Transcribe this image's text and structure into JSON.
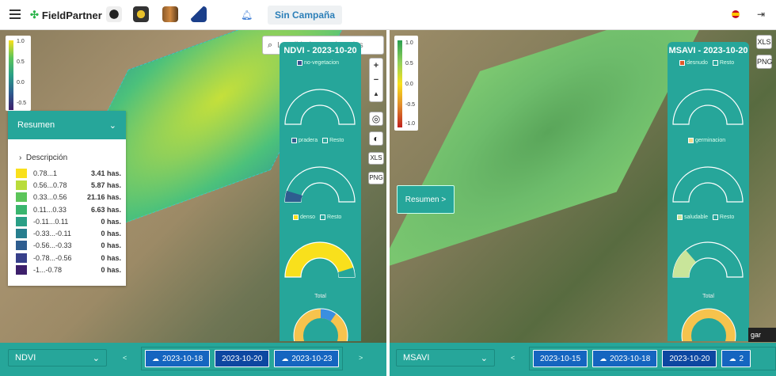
{
  "app": {
    "name": "FieldPartner",
    "campaign": "Sin Campaña"
  },
  "icons": {
    "menu": "hamburger-icon",
    "bell": "bell-icon",
    "flag": "spain-flag-icon",
    "logout": "logout-icon"
  },
  "search": {
    "placeholder": "Localidad, Coordenadas"
  },
  "left": {
    "legend": {
      "ticks": [
        "1.0",
        "0.5",
        "0.0",
        "-0.5"
      ]
    },
    "resumen": {
      "title": "Resumen",
      "description": "Descripción",
      "rows": [
        {
          "range": "0.78...1",
          "value": "3.41 has.",
          "color": "#f9e01c"
        },
        {
          "range": "0.56...0.78",
          "value": "5.87 has.",
          "color": "#b9dc3a"
        },
        {
          "range": "0.33...0.56",
          "value": "21.16 has.",
          "color": "#5cc55a"
        },
        {
          "range": "0.11...0.33",
          "value": "6.63 has.",
          "color": "#39b56e"
        },
        {
          "range": "-0.11...0.11",
          "value": "0 has.",
          "color": "#2a9f86"
        },
        {
          "range": "-0.33...-0.11",
          "value": "0 has.",
          "color": "#277e8e"
        },
        {
          "range": "-0.56...-0.33",
          "value": "0 has.",
          "color": "#2e5d8f"
        },
        {
          "range": "-0.78...-0.56",
          "value": "0 has.",
          "color": "#37408a"
        },
        {
          "range": "-1...-0.78",
          "value": "0 has.",
          "color": "#3d1f6b"
        }
      ]
    },
    "panel": {
      "title": "NDVI - 2023-10-20",
      "g1": {
        "a": "no-vegetacion"
      },
      "g2": {
        "a": "pradera",
        "b": "Resto"
      },
      "g3": {
        "a": "denso",
        "b": "Resto"
      },
      "total": "Total"
    },
    "layer": "NDVI",
    "dates": [
      "2023-10-18",
      "2023-10-20",
      "2023-10-23"
    ],
    "prev": "<",
    "next": ">"
  },
  "right": {
    "legend": {
      "ticks": [
        "1.0",
        "0.5",
        "0.0",
        "-0.5",
        "-1.0"
      ]
    },
    "resumen_btn": "Resumen >",
    "panel": {
      "title": "MSAVI - 2023-10-20",
      "g1": {
        "a": "desnudo",
        "b": "Resto"
      },
      "g2": {
        "a": "germinacion"
      },
      "g3": {
        "a": "saludable",
        "b": "Resto"
      },
      "total": "Total"
    },
    "layer": "MSAVI",
    "dates": [
      "2023-10-15",
      "2023-10-18",
      "2023-10-20",
      "2"
    ],
    "prev": "<",
    "next": ">",
    "tag": "gar"
  },
  "tools": {
    "plus": "+",
    "minus": "−",
    "compass": "▲",
    "xls": "XLS",
    "png": "PNG"
  }
}
